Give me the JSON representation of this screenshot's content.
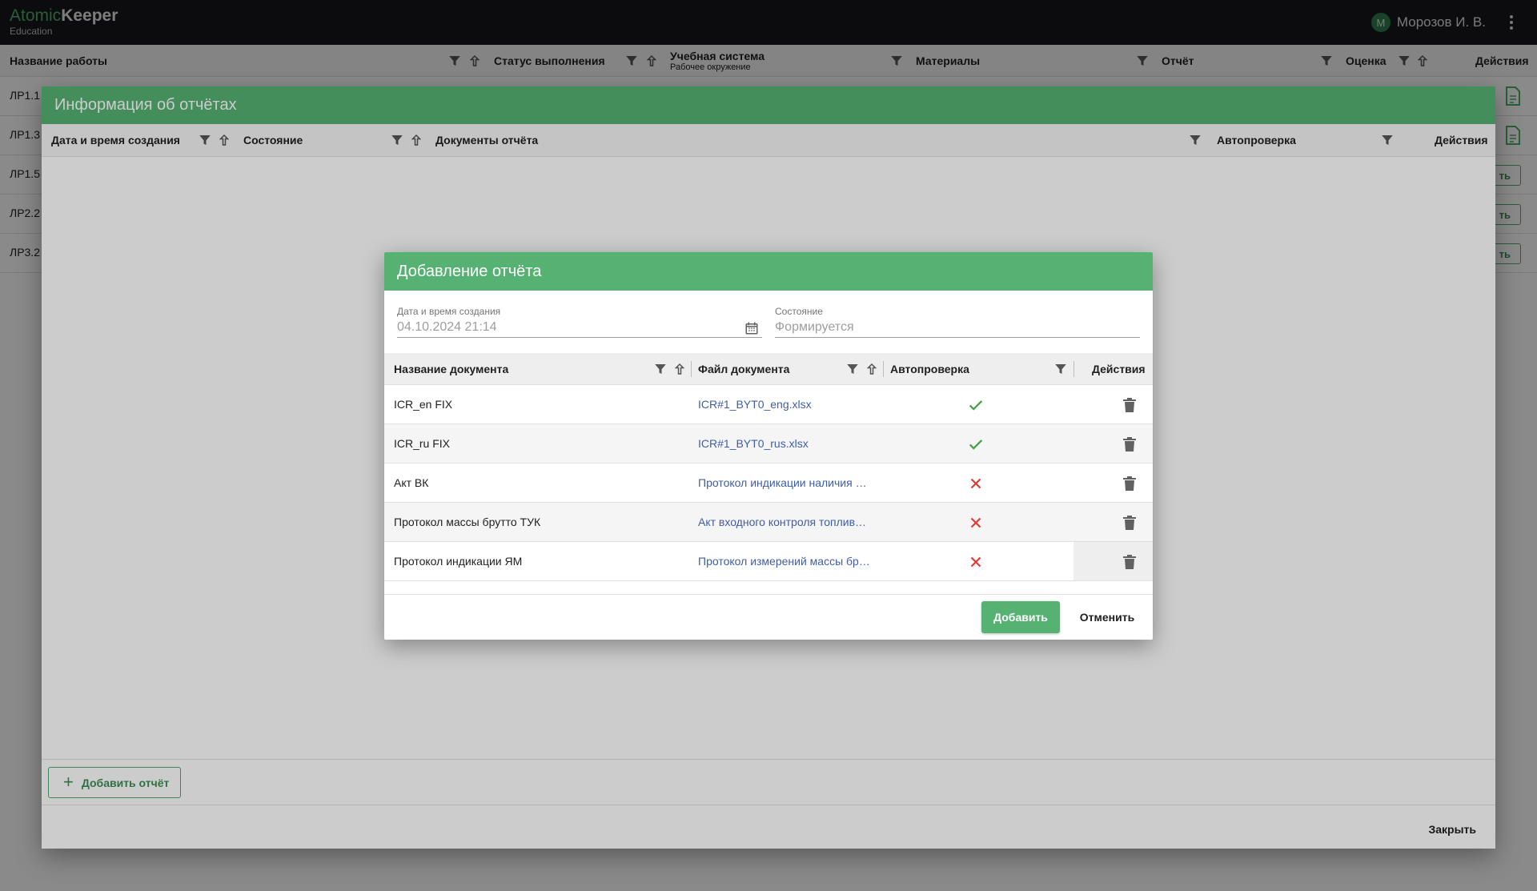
{
  "app": {
    "logo_part1": "Atomic",
    "logo_part2": "Keeper",
    "logo_sub": "Education",
    "user_initial": "М",
    "user_name": "Морозов И. В."
  },
  "main_table": {
    "headers": {
      "name": "Название работы",
      "status": "Статус выполнения",
      "system": "Учебная система",
      "system_sub": "Рабочее окружение",
      "materials": "Материалы",
      "report": "Отчёт",
      "grade": "Оценка",
      "actions": "Действия"
    },
    "rows": [
      "ЛР1.1",
      "ЛР1.3",
      "ЛР1.5",
      "ЛР2.2",
      "ЛР3.2"
    ],
    "row_button_label": "ть"
  },
  "info_dialog": {
    "title": "Информация об отчётах",
    "headers": {
      "created": "Дата и время создания",
      "state": "Состояние",
      "documents": "Документы отчёта",
      "autocheck": "Автопроверка",
      "actions": "Действия"
    },
    "add_report_label": "Добавить отчёт",
    "close_label": "Закрыть"
  },
  "add_dialog": {
    "title": "Добавление отчёта",
    "created_label": "Дата и время создания",
    "created_value": "04.10.2024 21:14",
    "state_label": "Состояние",
    "state_value": "Формируется",
    "headers": {
      "doc_name": "Название документа",
      "doc_file": "Файл документа",
      "autocheck": "Автопроверка",
      "actions": "Действия"
    },
    "rows": [
      {
        "name": "ICR_en FIX",
        "file": "ICR#1_BYT0_eng.xlsx",
        "autocheck": "passed"
      },
      {
        "name": "ICR_ru FIX",
        "file": "ICR#1_BYT0_rus.xlsx",
        "autocheck": "passed"
      },
      {
        "name": "Акт ВК",
        "file": "Протокол индикации наличия …",
        "autocheck": "failed"
      },
      {
        "name": "Протокол массы брутто ТУК",
        "file": "Акт входного контроля топлив…",
        "autocheck": "failed"
      },
      {
        "name": "Протокол индикации ЯМ",
        "file": "Протокол измерений массы бр…",
        "autocheck": "failed"
      }
    ],
    "add_button": "Добавить",
    "cancel_button": "Отменить"
  },
  "colors": {
    "brand_green": "#56b273",
    "check_green": "#43a047",
    "cross_red": "#e53935",
    "link_blue": "#3f5da8",
    "appbar_bg": "#17191d"
  }
}
